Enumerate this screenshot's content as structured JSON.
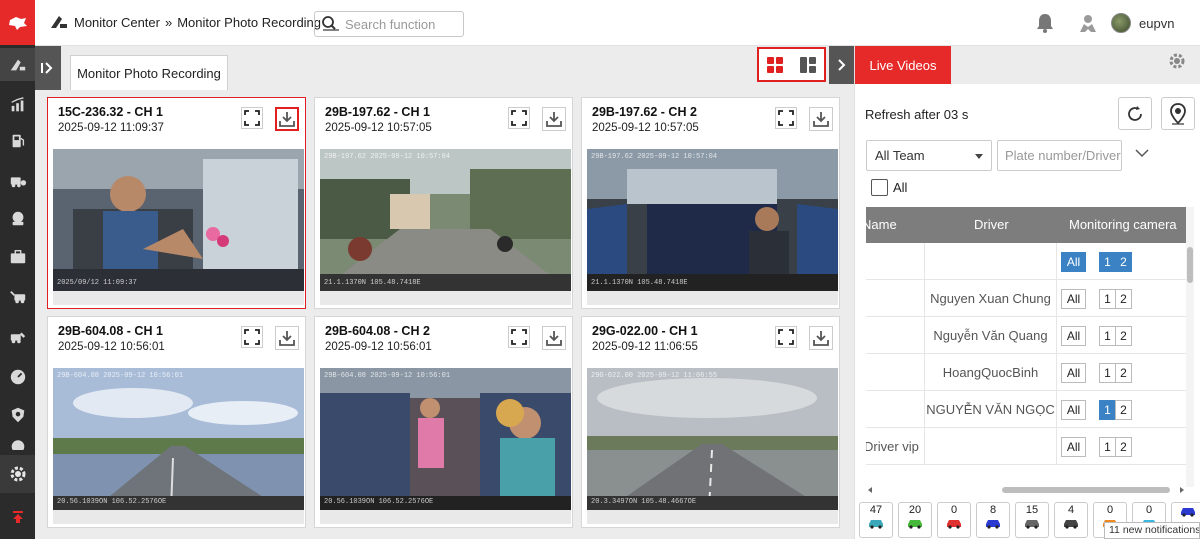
{
  "header": {
    "breadcrumb_root": "Monitor Center",
    "breadcrumb_sep": "»",
    "breadcrumb_page": "Monitor Photo Recording",
    "search_placeholder": "Search function",
    "username": "eupvn"
  },
  "tabs": {
    "active": "Monitor Photo Recording"
  },
  "cards": [
    {
      "title": "15C-236.32 - CH 1",
      "time": "2025-09-12 11:09:37",
      "overlay_top": "",
      "overlay_bottom": "2025/09/12 11:09:37",
      "scene": "cabin"
    },
    {
      "title": "29B-197.62 - CH 1",
      "time": "2025-09-12 10:57:05",
      "overlay_top": "29B-197.62  2025-09-12 10:57:04",
      "overlay_bottom": "21.1.1370N 105.48.7418E",
      "scene": "street"
    },
    {
      "title": "29B-197.62 - CH 2",
      "time": "2025-09-12 10:57:05",
      "overlay_top": "29B-197.62  2025-09-12 10:57:04",
      "overlay_bottom": "21.1.1370N 105.48.7418E",
      "scene": "bus"
    },
    {
      "title": "29B-604.08 - CH 1",
      "time": "2025-09-12 10:56:01",
      "overlay_top": "29B-604.08  2025-09-12 10:56:01",
      "overlay_bottom": "20.56.1039ON 106.52.2576OE",
      "scene": "highway"
    },
    {
      "title": "29B-604.08 - CH 2",
      "time": "2025-09-12 10:56:01",
      "overlay_top": "29B-604.08  2025-09-12 10:56:01",
      "overlay_bottom": "20.56.1039ON 106.52.2576OE",
      "scene": "passengers"
    },
    {
      "title": "29G-022.00 - CH 1",
      "time": "2025-09-12 11:06:55",
      "overlay_top": "29G-022.00  2025-09-12 11:06:55",
      "overlay_bottom": "20.3.3497ON 105.48.4667OE",
      "scene": "road"
    }
  ],
  "right_panel": {
    "live_tab": "Live Videos",
    "refresh_text": "Refresh after 03 s",
    "team_select": "All Team",
    "plate_placeholder": "Plate number/Driver",
    "all_label": "All",
    "columns": {
      "name": "Name",
      "driver": "Driver",
      "camera": "Monitoring camera"
    },
    "rows": [
      {
        "name": "",
        "driver": "",
        "all_on": true,
        "ch1_on": true,
        "ch2_on": true
      },
      {
        "name": "",
        "driver": "Nguyen Xuan Chung",
        "all_on": false,
        "ch1_on": false,
        "ch2_on": false
      },
      {
        "name": "",
        "driver": "Nguyễn Văn Quang",
        "all_on": false,
        "ch1_on": false,
        "ch2_on": false
      },
      {
        "name": "",
        "driver": "HoangQuocBinh",
        "all_on": false,
        "ch1_on": false,
        "ch2_on": false
      },
      {
        "name": "",
        "driver": "NGUYỄN VĂN NGỌC",
        "all_on": false,
        "ch1_on": true,
        "ch2_on": false
      },
      {
        "name": "Driver vip",
        "driver": "",
        "all_on": false,
        "ch1_on": false,
        "ch2_on": false
      }
    ],
    "btn_all": "All",
    "btn_ch1": "1",
    "btn_ch2": "2",
    "counters": [
      {
        "count": "47",
        "color": "#3aa8b8",
        "icon": "car-checked-icon"
      },
      {
        "count": "20",
        "color": "#46b83a",
        "icon": "car-green-icon"
      },
      {
        "count": "0",
        "color": "#e03030",
        "icon": "car-red-icon"
      },
      {
        "count": "8",
        "color": "#2a3ad0",
        "icon": "car-blue-icon"
      },
      {
        "count": "15",
        "color": "#666666",
        "icon": "car-gray-icon"
      },
      {
        "count": "4",
        "color": "#444444",
        "icon": "car-outline-icon"
      },
      {
        "count": "0",
        "color": "#f08a20",
        "icon": "car-orange-icon"
      },
      {
        "count": "0",
        "color": "#3ab8e0",
        "icon": "car-cyan-icon"
      },
      {
        "count": "",
        "color": "#2a3ad0",
        "icon": "car-navy-icon"
      }
    ]
  },
  "toast": "11 new notifications"
}
